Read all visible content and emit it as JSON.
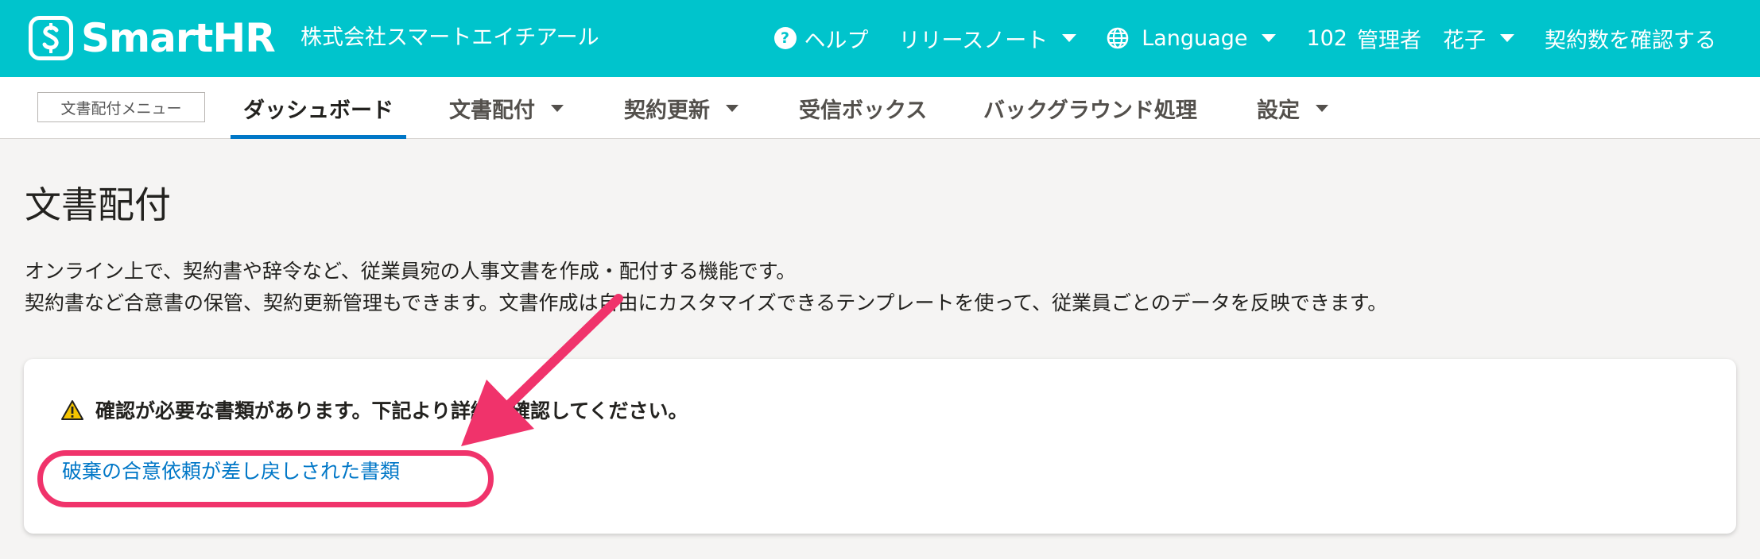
{
  "header": {
    "brand_name": "SmartHR",
    "company_name": "株式会社スマートエイチアール",
    "nav": {
      "help": "ヘルプ",
      "release_notes": "リリースノート",
      "language": "Language",
      "user_number": "102",
      "user_name": "管理者　花子",
      "check_contracts": "契約数を確認する"
    },
    "colors": {
      "bar": "#00c4cc"
    }
  },
  "subnav": {
    "menu_label": "文書配付メニュー",
    "tabs": [
      {
        "label": "ダッシュボード",
        "active": true
      },
      {
        "label": "文書配付",
        "dropdown": true
      },
      {
        "label": "契約更新",
        "dropdown": true
      },
      {
        "label": "受信ボックス"
      },
      {
        "label": "バックグラウンド処理"
      },
      {
        "label": "設定",
        "dropdown": true
      }
    ],
    "colors": {
      "active_underline": "#0077c7"
    }
  },
  "main": {
    "title": "文書配付",
    "description": [
      "オンライン上で、契約書や辞令など、従業員宛の人事文書を作成・配付する機能です。",
      "契約書など合意書の保管、契約更新管理もできます。文書作成は自由にカスタマイズできるテンプレートを使って、従業員ごとのデータを反映できます。"
    ],
    "alert": {
      "icon": "warning-icon",
      "message": "確認が必要な書類があります。下記より詳細を確認してください。",
      "link": "破棄の合意依頼が差し戻しされた書類"
    }
  },
  "annotation": {
    "color": "#f0336b",
    "type": "arrow-and-circle"
  }
}
